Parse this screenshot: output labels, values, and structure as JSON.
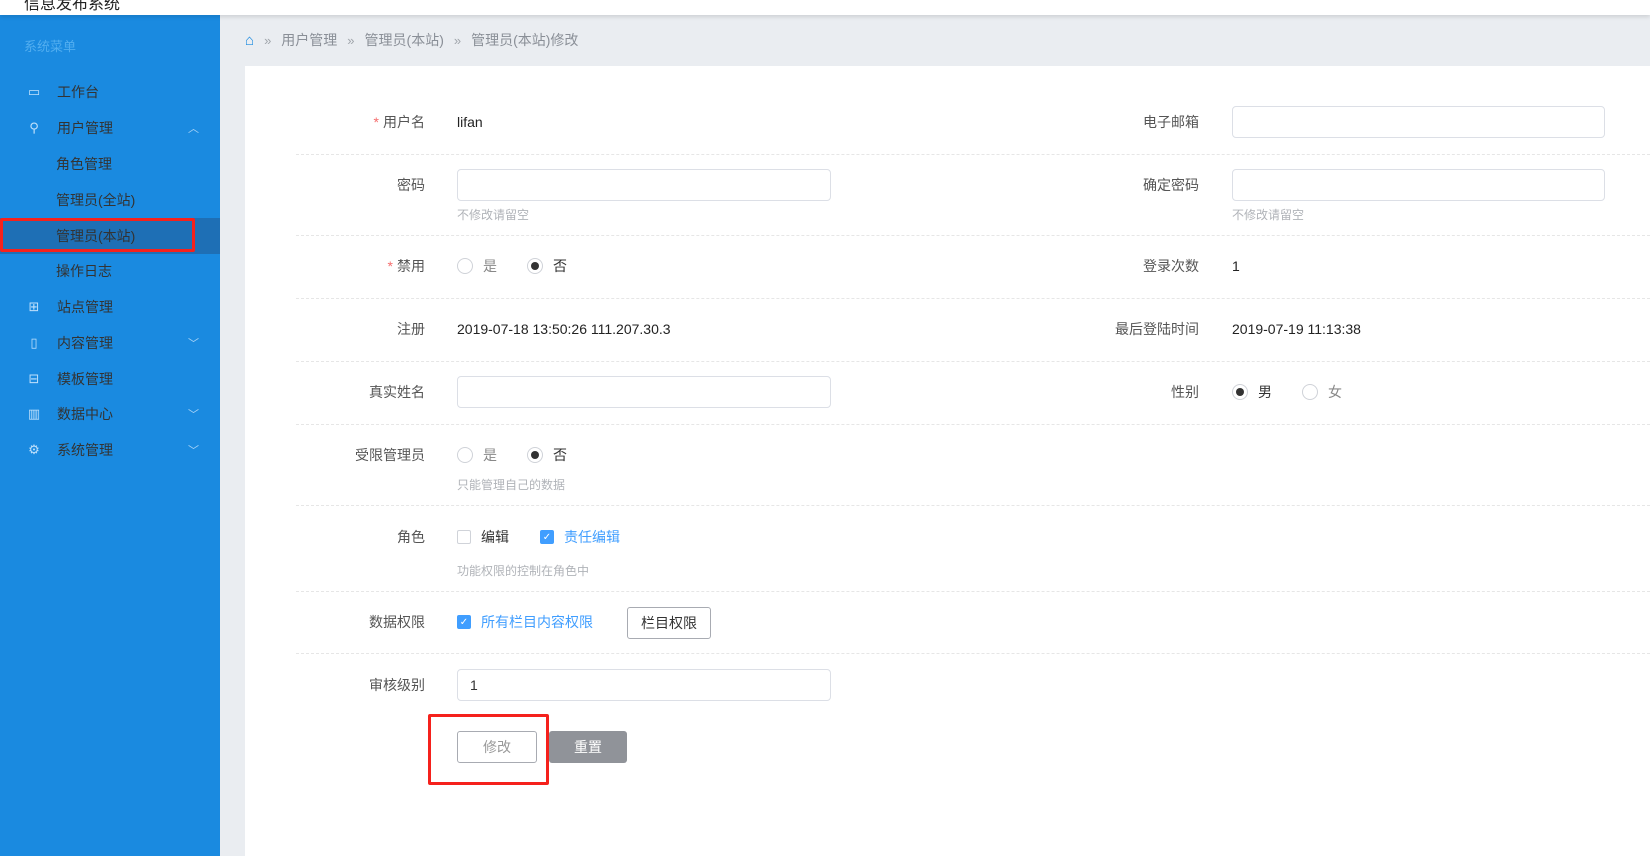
{
  "header": {
    "title": "信息发布系统"
  },
  "sidebar": {
    "menu_title": "系统菜单",
    "items": [
      {
        "label": "工作台",
        "icon": "monitor-icon"
      },
      {
        "label": "用户管理",
        "icon": "user-icon",
        "expanded": true
      },
      {
        "label": "角色管理"
      },
      {
        "label": "管理员(全站)"
      },
      {
        "label": "管理员(本站)",
        "active": true
      },
      {
        "label": "操作日志"
      },
      {
        "label": "站点管理",
        "icon": "grid-icon"
      },
      {
        "label": "内容管理",
        "icon": "file-icon"
      },
      {
        "label": "模板管理",
        "icon": "template-icon"
      },
      {
        "label": "数据中心",
        "icon": "bar-chart-icon"
      },
      {
        "label": "系统管理",
        "icon": "gear-icon"
      }
    ]
  },
  "breadcrumb": [
    "用户管理",
    "管理员(本站)",
    "管理员(本站)修改"
  ],
  "form": {
    "username": {
      "label": "用户名",
      "value": "lifan"
    },
    "email": {
      "label": "电子邮箱",
      "value": ""
    },
    "password": {
      "label": "密码",
      "value": "",
      "hint": "不修改请留空"
    },
    "confirm_password": {
      "label": "确定密码",
      "value": "",
      "hint": "不修改请留空"
    },
    "disabled": {
      "label": "禁用",
      "options": [
        "是",
        "否"
      ],
      "selected": "否"
    },
    "login_count": {
      "label": "登录次数",
      "value": "1"
    },
    "register": {
      "label": "注册",
      "value": "2019-07-18 13:50:26 111.207.30.3"
    },
    "last_login": {
      "label": "最后登陆时间",
      "value": "2019-07-19 11:13:38"
    },
    "real_name": {
      "label": "真实姓名",
      "value": ""
    },
    "gender": {
      "label": "性别",
      "options": [
        "男",
        "女"
      ],
      "selected": "男"
    },
    "limited_admin": {
      "label": "受限管理员",
      "options": [
        "是",
        "否"
      ],
      "selected": "否",
      "hint": "只能管理自己的数据"
    },
    "role": {
      "label": "角色",
      "options": [
        {
          "label": "编辑",
          "checked": false
        },
        {
          "label": "责任编辑",
          "checked": true
        }
      ],
      "hint": "功能权限的控制在角色中"
    },
    "data_permission": {
      "label": "数据权限",
      "checkbox": "所有栏目内容权限",
      "checked": true,
      "button": "栏目权限"
    },
    "review_level": {
      "label": "审核级别",
      "value": "1"
    },
    "submit": "修改",
    "reset": "重置"
  },
  "colors": {
    "sidebar": "#1a8ae0",
    "active": "#1e6fb5",
    "accent": "#409eff",
    "highlight": "#f5211c"
  }
}
